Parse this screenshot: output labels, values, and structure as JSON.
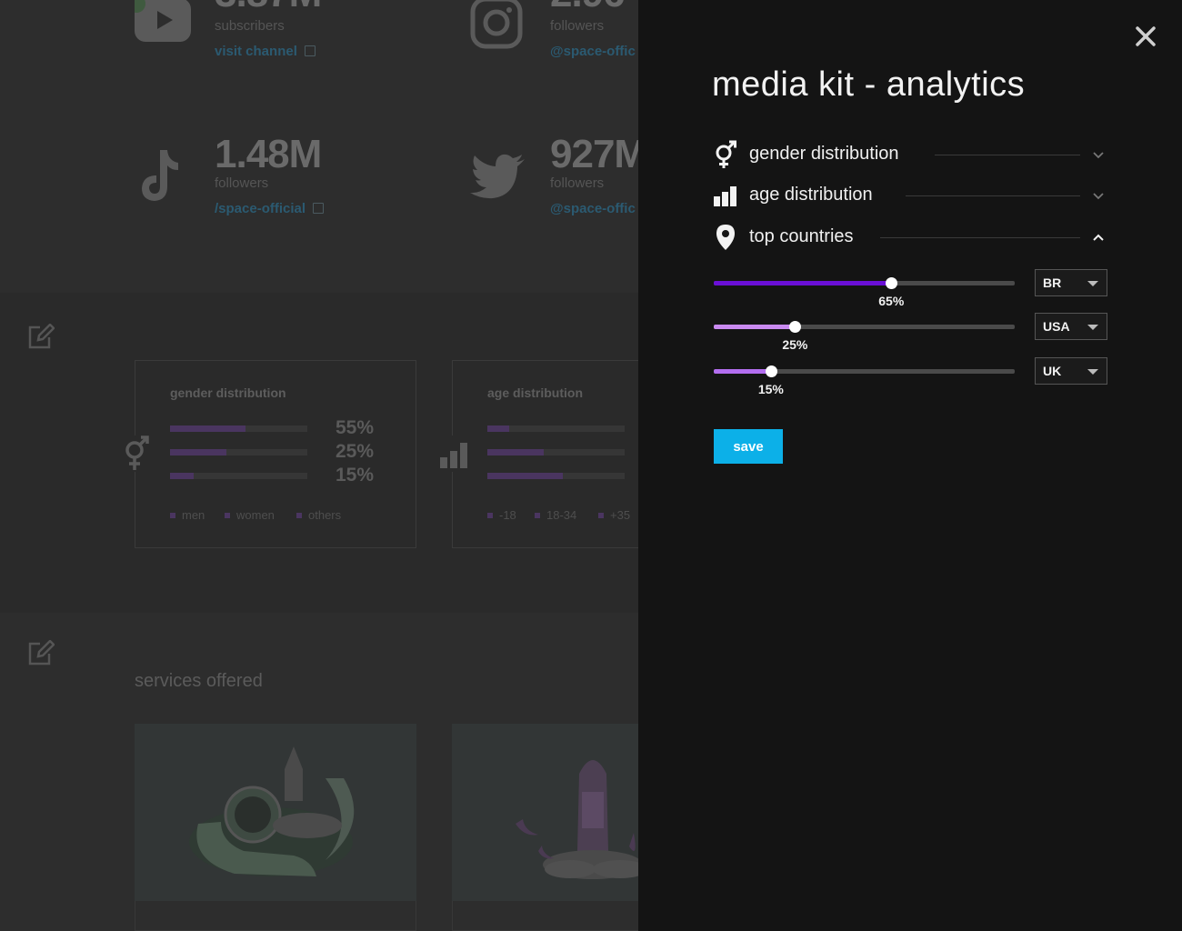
{
  "background": {
    "stats": [
      {
        "platform": "youtube",
        "value": "3.87M",
        "label": "subscribers",
        "link": "visit channel"
      },
      {
        "platform": "instagram",
        "value": "2.96",
        "label": "followers",
        "link": "@space-offic"
      },
      {
        "platform": "tiktok",
        "value": "1.48M",
        "label": "followers",
        "link": "/space-official"
      },
      {
        "platform": "twitter",
        "value": "927M",
        "label": "followers",
        "link": "@space-offic"
      }
    ],
    "gender_card": {
      "title": "gender distribution",
      "rows": [
        {
          "pct": "55%",
          "fill": 0.55
        },
        {
          "pct": "25%",
          "fill": 0.41
        },
        {
          "pct": "15%",
          "fill": 0.17
        }
      ],
      "legend": [
        "men",
        "women",
        "others"
      ]
    },
    "age_card": {
      "title": "age distribution",
      "rows": [
        {
          "fill": 0.16
        },
        {
          "fill": 0.41
        },
        {
          "fill": 0.55
        }
      ],
      "legend": [
        "-18",
        "18-34",
        "+35"
      ]
    },
    "services_title": "services offered"
  },
  "panel": {
    "title": "media kit - analytics",
    "sections": [
      {
        "label": "gender distribution",
        "icon": "gender-icon",
        "expanded": false
      },
      {
        "label": "age distribution",
        "icon": "bar-chart-icon",
        "expanded": false
      },
      {
        "label": "top countries",
        "icon": "location-pin-icon",
        "expanded": true
      }
    ],
    "countries": [
      {
        "country": "BR",
        "percent_label": "65%",
        "value": 0.59,
        "color": "#6a0fd6"
      },
      {
        "country": "USA",
        "percent_label": "25%",
        "value": 0.27,
        "color": "#c98af0"
      },
      {
        "country": "UK",
        "percent_label": "15%",
        "value": 0.19,
        "color": "#b36ef0"
      }
    ],
    "save_label": "save"
  }
}
